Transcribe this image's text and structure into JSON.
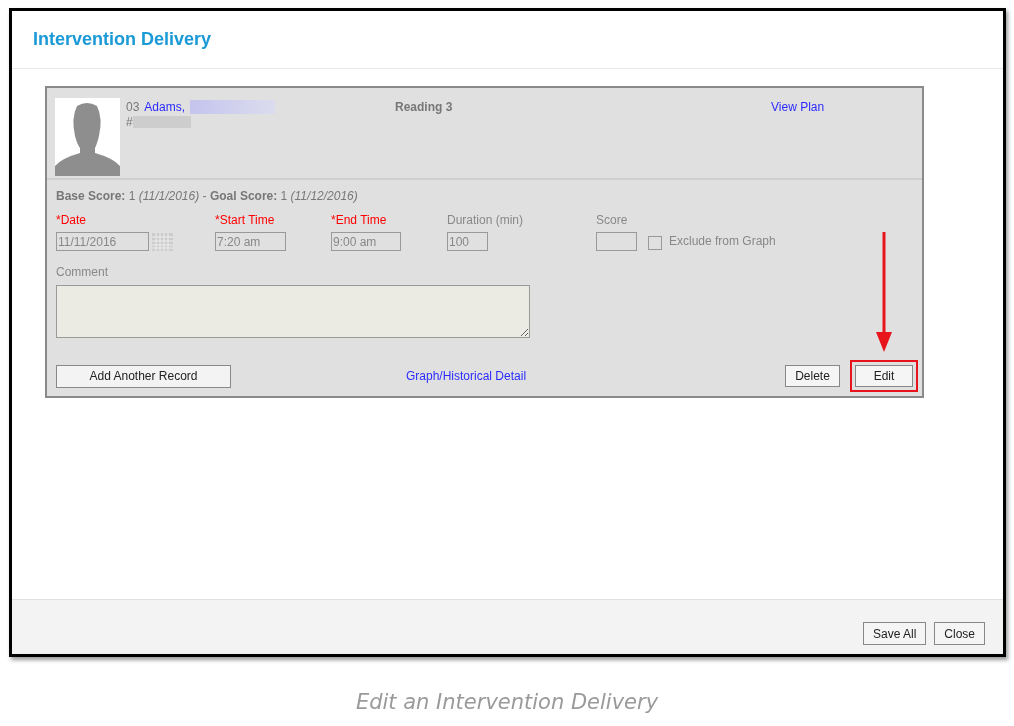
{
  "window": {
    "title": "Intervention Delivery"
  },
  "student": {
    "grade": "03",
    "name": "Adams,",
    "id_prefix": "#",
    "course": "Reading 3",
    "view_plan": "View Plan"
  },
  "scores": "**Base Score:** 1 *(11/1/2016)* - **Goal Score:** 1 *(11/12/2016)*",
  "fields": [
    {
      "kind": "date",
      "label": "*Date",
      "required": true,
      "value": "11/11/2016"
    },
    {
      "kind": "text",
      "label": "*Start Time",
      "required": true,
      "value": "7:20 am"
    },
    {
      "kind": "text",
      "label": "*End Time",
      "required": true,
      "value": "9:00 am"
    },
    {
      "kind": "text",
      "label": "Duration (min)",
      "required": false,
      "value": "100"
    },
    {
      "kind": "text",
      "label": "Score",
      "required": false
    }
  ],
  "exclude": {
    "label": "Exclude from Graph",
    "checked": false
  },
  "comment": {
    "label": "Comment"
  },
  "actions": {
    "add": "Add Another Record",
    "graph_link": "Graph/Historical Detail",
    "buttons": [
      {
        "label": "Delete",
        "highlighted": false
      },
      {
        "label": "Edit",
        "highlighted": true
      }
    ]
  },
  "footer": {
    "buttons": [
      "Save All",
      "Close"
    ]
  },
  "caption": "Edit an Intervention Delivery"
}
